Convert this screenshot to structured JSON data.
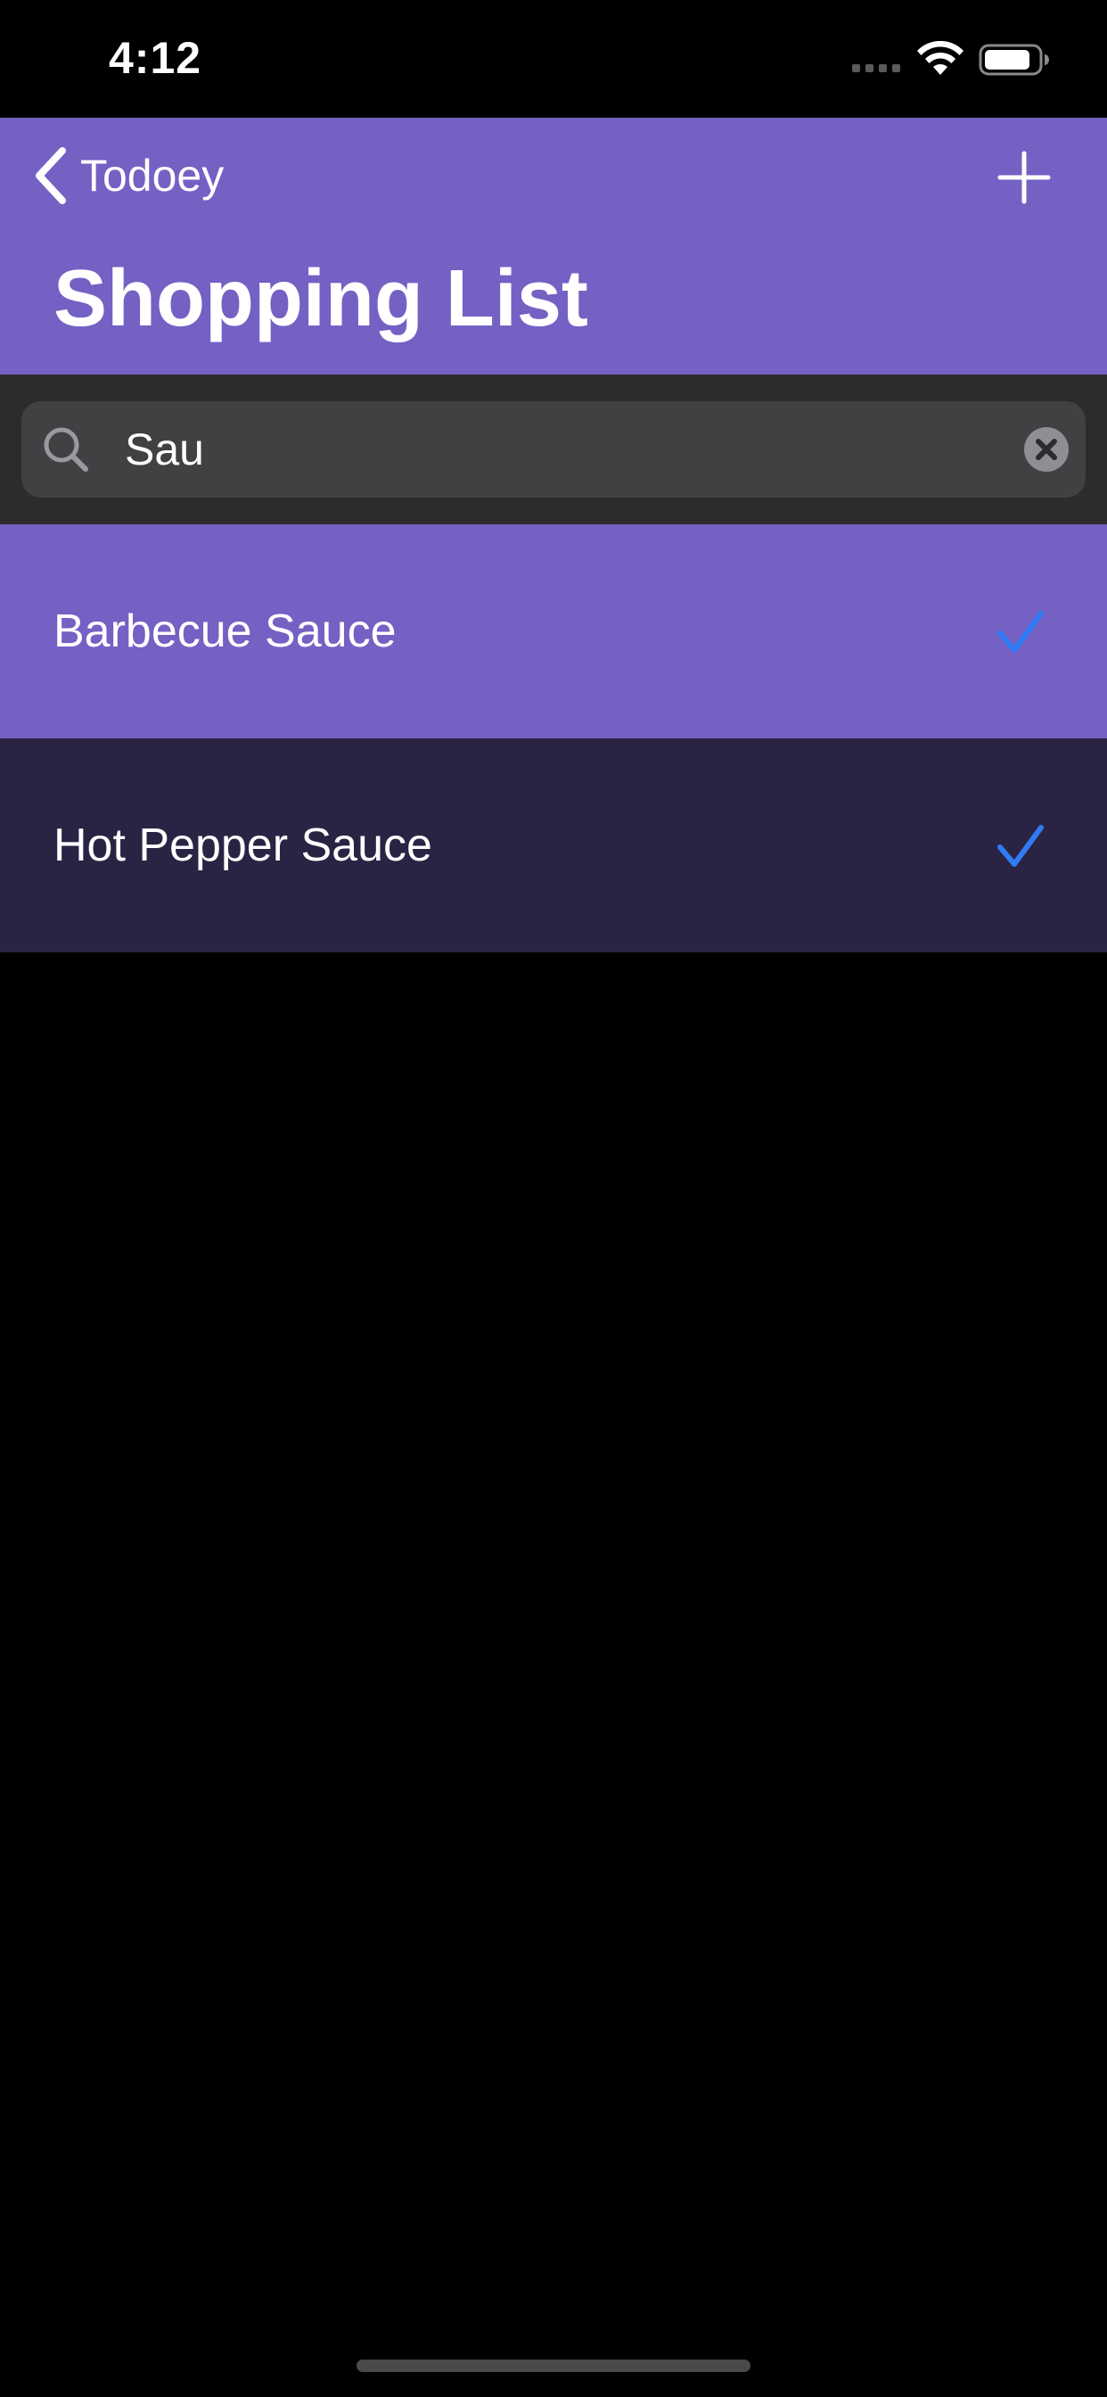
{
  "status_bar": {
    "time": "4:12"
  },
  "nav": {
    "back_label": "Todoey",
    "title": "Shopping List",
    "add_icon": "plus-icon"
  },
  "search": {
    "value": "Sau",
    "placeholder": "Search"
  },
  "items": [
    {
      "label": "Barbecue Sauce",
      "checked": true,
      "background": "#7560c4"
    },
    {
      "label": "Hot Pepper Sauce",
      "checked": true,
      "background": "#2a2344"
    }
  ],
  "colors": {
    "accent": "#7560c4",
    "checkmark": "#2f7cf6",
    "background": "#000000"
  }
}
